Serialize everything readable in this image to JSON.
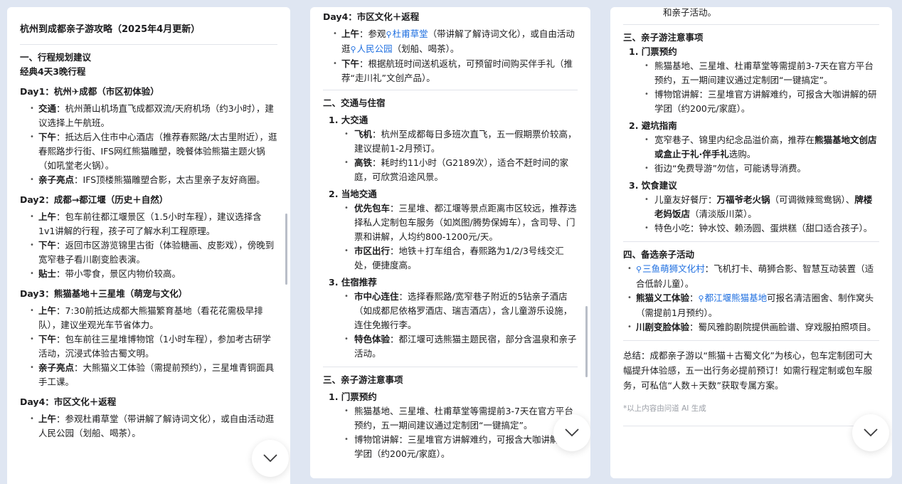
{
  "p1": {
    "title": "杭州到成都亲子游攻略（2025年4月更新）",
    "plan_heading": "一、行程规划建议",
    "plan_sub": "经典4天3晚行程",
    "day1": {
      "title": "Day1：杭州✈成都（市区初体验）",
      "items": [
        {
          "k": "交通",
          "t": "：杭州萧山机场直飞成都双流/天府机场（约3小时），建议选择上午航班。"
        },
        {
          "k": "下午",
          "t": "：抵达后入住市中心酒店（推荐春熙路/太古里附近），逛春熙路步行街、IFS网红熊猫雕塑，晚餐体验熊猫主题火锅（如吼堂老火锅）。"
        },
        {
          "k": "亲子亮点",
          "t": "：IFS顶楼熊猫雕塑合影，太古里亲子友好商圈。"
        }
      ]
    },
    "day2": {
      "title": "Day2：成都→都江堰（历史＋自然）",
      "items": [
        {
          "k": "上午",
          "t": "：包车前往都江堰景区（1.5小时车程），建议选择含1v1讲解的行程，孩子可了解水利工程原理。"
        },
        {
          "k": "下午",
          "t": "：返回市区游览锦里古街（体验糖画、皮影戏），傍晚到宽窄巷子看川剧变脸表演。"
        },
        {
          "k": "贴士",
          "t": "：带小零食，景区内物价较高。"
        }
      ]
    },
    "day3": {
      "title": "Day3：熊猫基地＋三星堆（萌宠与文化）",
      "items": [
        {
          "k": "上午",
          "t": "：7:30前抵达成都大熊猫繁育基地（看花花需极早排队），建议坐观光车节省体力。"
        },
        {
          "k": "下午",
          "t": "：包车前往三星堆博物馆（1小时车程），参加考古研学活动，沉浸式体验古蜀文明。"
        },
        {
          "k": "亲子亮点",
          "t": "：大熊猫义工体验（需提前预约），三星堆青铜面具手工课。"
        }
      ]
    },
    "day4": {
      "title": "Day4：市区文化＋返程",
      "items": [
        {
          "k": "上午",
          "t": "：参观杜甫草堂（带讲解了解诗词文化），或自由活动逛人民公园（划船、喝茶）。"
        }
      ]
    }
  },
  "p2": {
    "day4_title": "Day4：市区文化＋返程",
    "day4_items": [
      {
        "k": "上午",
        "a": "：参观",
        "loc1": "杜甫草堂",
        "b": "（带讲解了解诗词文化），或自由活动逛",
        "loc2": "人民公园",
        "c": "（划船、喝茶）。"
      },
      {
        "k": "下午",
        "a": "：根据航班时间送机返杭，可预留时间购买伴手礼（推荐“走川礼”文创产品）。",
        "loc1": "",
        "b": "",
        "loc2": "",
        "c": ""
      }
    ],
    "transport_heading": "二、交通与住宿",
    "t1": {
      "title": "1.  大交通",
      "items": [
        {
          "k": "飞机",
          "t": "：杭州至成都每日多班次直飞，五一假期票价较高，建议提前1-2月预订。"
        },
        {
          "k": "高铁",
          "t": "：耗时约11小时（G2189次），适合不赶时间的家庭，可欣赏沿途风景。"
        }
      ]
    },
    "t2": {
      "title": "2.  当地交通",
      "items": [
        {
          "k": "优先包车",
          "t": "：三星堆、都江堰等景点距离市区较远，推荐选择私人定制包车服务（如岚图/腾势保姆车），含司导、门票和讲解，人均约800-1200元/天。"
        },
        {
          "k": "市区出行",
          "t": "：地铁＋打车组合，春熙路为1/2/3号线交汇处，便捷度高。"
        }
      ]
    },
    "t3": {
      "title": "3.  住宿推荐",
      "items": [
        {
          "k": "市中心连住",
          "t": "：选择春熙路/宽窄巷子附近的5钻亲子酒店（如成都尼依格罗酒店、瑞吉酒店），含儿童游乐设施，连住免搬行李。"
        },
        {
          "k": "特色体验",
          "t": "：都江堰可选熊猫主题民宿，部分含温泉和亲子活动。"
        }
      ]
    },
    "notes_heading": "三、亲子游注意事项",
    "n1": {
      "title": "1.  门票预约",
      "items": [
        {
          "k": "",
          "t": "熊猫基地、三星堆、杜甫草堂等需提前3-7天在官方平台预约，五一期间建议通过定制团“一键搞定”。"
        },
        {
          "k": "",
          "t": "博物馆讲解：三星堆官方讲解难约，可报含大咖讲解的研学团（约200元/家庭）。"
        }
      ]
    }
  },
  "p3": {
    "top_text": "和亲子活动。",
    "notes_heading": "三、亲子游注意事项",
    "n1": {
      "title": "1.  门票预约",
      "items": [
        "熊猫基地、三星堆、杜甫草堂等需提前3-7天在官方平台预约，五一期间建议通过定制团“一键搞定”。",
        "博物馆讲解：三星堆官方讲解难约，可报含大咖讲解的研学团（约200元/家庭）。"
      ]
    },
    "n2": {
      "title": "2.  避坑指南",
      "items": [
        {
          "a": "宽窄巷子、锦里内纪念品溢价高，推荐在",
          "k": "熊猫基地文创店或盒止于礼·伴手礼",
          "b": "选购。"
        },
        {
          "a": "街边“免费导游”勿信，可能诱导消费。",
          "k": "",
          "b": ""
        }
      ]
    },
    "n3": {
      "title": "3.  饮食建议",
      "items": [
        {
          "a": "儿童友好餐厅：",
          "k": "万福爷老火锅",
          "b": "（可调微辣鸳鸯锅）、",
          "k2": "牌楼老妈饭店",
          "c": "（清淡版川菜）。"
        },
        {
          "a": "特色小吃：钟水饺、赖汤圆、蛋烘糕（甜口适合孩子）。",
          "k": "",
          "b": "",
          "k2": "",
          "c": ""
        }
      ]
    },
    "alt_heading": "四、备选亲子活动",
    "alt_items": [
      {
        "loc": "三鱼萌狮文化村",
        "t": "：飞机打卡、萌狮合影、智慧互动装置（适合低龄儿童）。"
      },
      {
        "k": "熊猫义工体验",
        "a": "：",
        "loc": "都江堰熊猫基地",
        "t": "可报名清洁圈舍、制作窝头（需提前1月预约）。"
      },
      {
        "k": "川剧变脸体验",
        "t": "：蜀风雅韵剧院提供画脸谱、穿戏服拍照项目。"
      }
    ],
    "summary": "总结：成都亲子游以“熊猫＋古蜀文化”为核心，包车定制团可大幅提升体验感，五一出行务必提前预订！如需行程定制或包车服务，可私信“人数＋天数”获取专属方案。",
    "ai_note": "*以上内容由问道 AI 生成"
  },
  "icons": {
    "scroll_down": "chevron-down-icon",
    "pin": "location-pin-icon"
  }
}
